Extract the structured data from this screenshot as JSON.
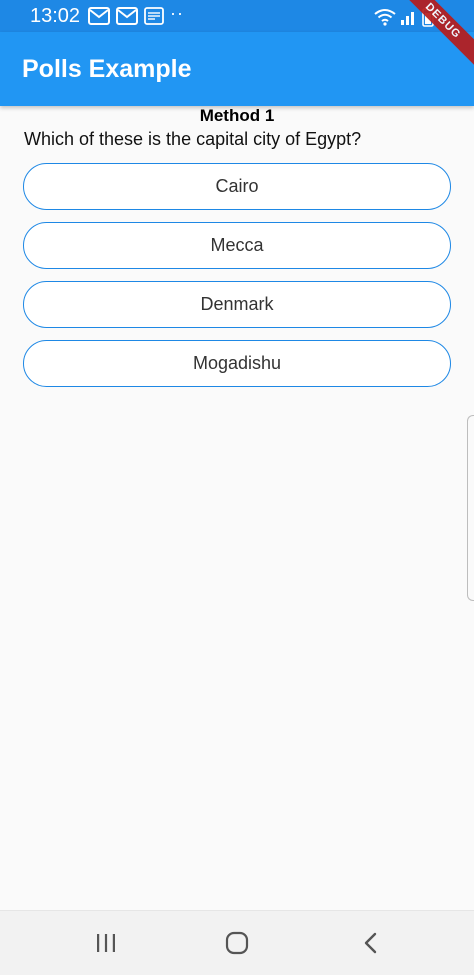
{
  "status_bar": {
    "time": "13:02",
    "dots": "··",
    "notification_icons": [
      "gmail-icon",
      "gmail-icon",
      "news-icon"
    ],
    "system_icons": [
      "wifi-icon",
      "signal-icon",
      "battery-icon"
    ]
  },
  "debug_banner": {
    "label": "DEBUG",
    "color": "#b71c1c"
  },
  "app_bar": {
    "title": "Polls Example",
    "color": "#2196f3"
  },
  "poll": {
    "heading": "Method 1",
    "question": "Which of these is the capital city of Egypt?",
    "options": [
      {
        "label": "Cairo"
      },
      {
        "label": "Mecca"
      },
      {
        "label": "Denmark"
      },
      {
        "label": "Mogadishu"
      }
    ],
    "border_color": "#1e88e5"
  },
  "nav_bar": {
    "buttons": [
      "recents-icon",
      "home-icon",
      "back-icon"
    ]
  }
}
